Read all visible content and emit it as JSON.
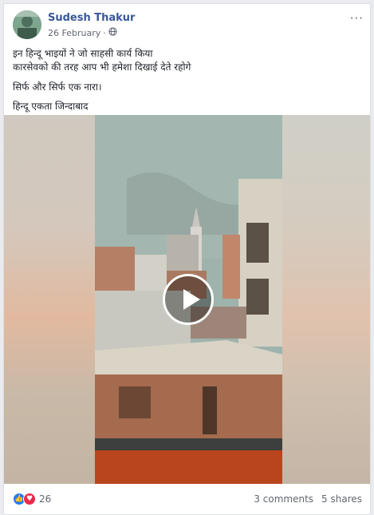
{
  "post": {
    "author": "Sudesh Thakur",
    "date": "26 February",
    "separator": "·",
    "more_icon": "···",
    "lines": [
      "इन हिन्दू भाइयों ने जो साहसी कार्य किया",
      "कारसेवको की तरह आप भी हमेशा दिखाई देते रहोगे",
      "सिर्फ और सिर्फ एक नारा।",
      "हिन्दू एकता जिन्दाबाद"
    ]
  },
  "reactions": {
    "count": "26",
    "like_icon": "👍",
    "love_icon": "♥"
  },
  "stats": {
    "comments": "3 comments",
    "shares": "5 shares"
  },
  "colors": {
    "author": "#385898",
    "like": "#2078f4",
    "love": "#f0284a"
  }
}
